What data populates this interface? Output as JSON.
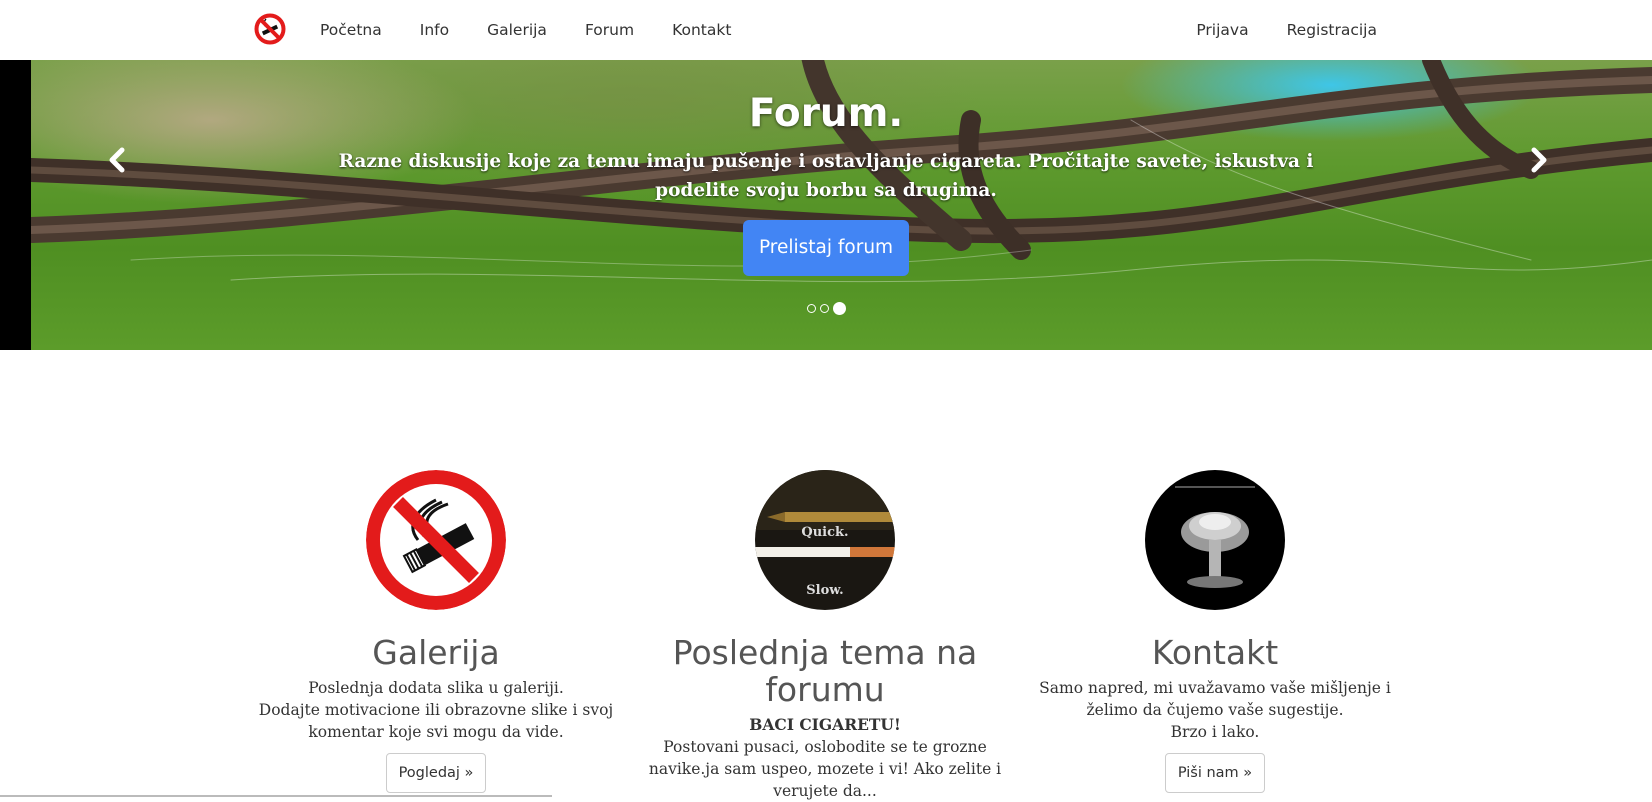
{
  "nav": {
    "brand_icon": "no-smoking-icon",
    "left_items": [
      "Početna",
      "Info",
      "Galerija",
      "Forum",
      "Kontakt"
    ],
    "right_items": [
      "Prijava",
      "Registracija"
    ]
  },
  "carousel": {
    "title": "Forum.",
    "text": "Razne diskusije koje za temu imaju pušenje i ostavljanje cigareta. Pročitajte savete, iskustva i podelite svoju borbu sa drugima.",
    "button_label": "Prelistaj forum",
    "button_color": "#4285f4",
    "slide_count": 3,
    "active_slide": 3,
    "prev_icon": "chevron-left-icon",
    "next_icon": "chevron-right-icon"
  },
  "columns": [
    {
      "heading": "Galerija",
      "lines": [
        "Poslednja dodata slika u galeriji.",
        "Dodajte motivacione ili obrazovne slike i svoj komentar koje svi mogu da vide."
      ],
      "button_label": "Pogledaj »",
      "image_icon": "no-smoking-icon"
    },
    {
      "heading": "Poslednja tema na forumu",
      "topic_title": "BACI CIGARETU!",
      "topic_excerpt": "Postovani pusaci, oslobodite se te grozne navike.ja sam uspeo, mozete i vi! Ako zelite i verujete da...",
      "image_text_top": "Quick.",
      "image_text_bottom": "Slow."
    },
    {
      "heading": "Kontakt",
      "lines": [
        "Samo napred, mi uvažavamo vaše mišljenje i želimo da čujemo vaše sugestije.",
        "Brzo i lako."
      ],
      "button_label": "Piši nam »",
      "image_icon": "mushroom-cloud-icon"
    }
  ]
}
